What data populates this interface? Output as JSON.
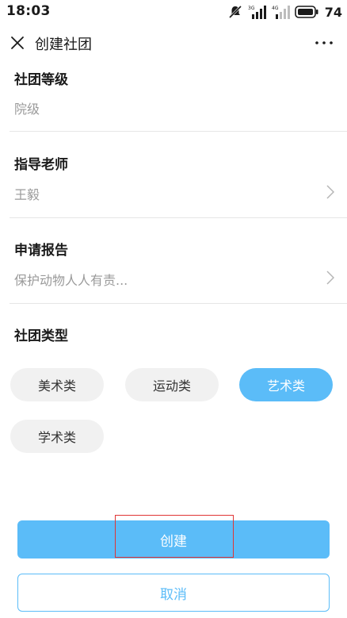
{
  "status_bar": {
    "time": "18:03",
    "network_3g": "3G",
    "network_4g": "4G",
    "battery": "74"
  },
  "nav": {
    "title": "创建社团"
  },
  "form": {
    "level_label": "社团等级",
    "level_value": "院级",
    "advisor_label": "指导老师",
    "advisor_value": "王毅",
    "report_label": "申请报告",
    "report_value": "保护动物人人有责...",
    "type_label": "社团类型"
  },
  "types": {
    "option_1": "美术类",
    "option_2": "运动类",
    "option_3": "艺术类",
    "option_4": "学术类",
    "selected": "艺术类"
  },
  "actions": {
    "create": "创建",
    "cancel": "取消"
  },
  "colors": {
    "accent": "#5bbcf8",
    "highlight": "#e03535"
  }
}
